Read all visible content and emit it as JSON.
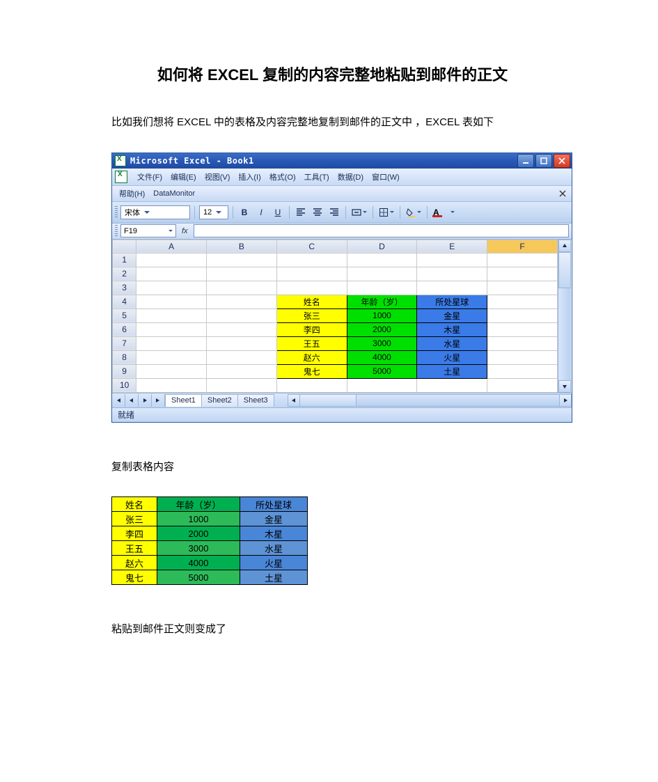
{
  "doc": {
    "title": "如何将 EXCEL  复制的内容完整地粘贴到邮件的正文",
    "para1": "比如我们想将 EXCEL  中的表格及内容完整地复制到邮件的正文中 ，EXCEL  表如下",
    "para2": "复制表格内容",
    "para3": "粘贴到邮件正文则变成了"
  },
  "excel": {
    "title": "Microsoft Excel - Book1",
    "winbtn_min": "minimize-icon",
    "winbtn_max": "maximize-icon",
    "winbtn_close": "close-icon",
    "menu": {
      "file": "文件(F)",
      "edit": "编辑(E)",
      "view": "视图(V)",
      "insert": "插入(I)",
      "format": "格式(O)",
      "tools": "工具(T)",
      "data": "数据(D)",
      "window": "窗口(W)"
    },
    "menu2": {
      "help": "帮助(H)",
      "datamonitor": "DataMonitor"
    },
    "toolbar": {
      "font": "宋体",
      "size": "12",
      "bold": "B",
      "italic": "I",
      "underline": "U"
    },
    "formula": {
      "namebox": "F19",
      "fx": "fx"
    },
    "columns": [
      "A",
      "B",
      "C",
      "D",
      "E",
      "F"
    ],
    "active_col": "F",
    "rows": [
      1,
      2,
      3,
      4,
      5,
      6,
      7,
      8,
      9,
      10
    ],
    "table": {
      "header": {
        "name": "姓名",
        "age": "年龄（岁）",
        "planet": "所处星球"
      },
      "data": [
        {
          "name": "张三",
          "age": "1000",
          "planet": "金星"
        },
        {
          "name": "李四",
          "age": "2000",
          "planet": "木星"
        },
        {
          "name": "王五",
          "age": "3000",
          "planet": "水星"
        },
        {
          "name": "赵六",
          "age": "4000",
          "planet": "火星"
        },
        {
          "name": "鬼七",
          "age": "5000",
          "planet": "土星"
        }
      ]
    },
    "sheets": [
      "Sheet1",
      "Sheet2",
      "Sheet3"
    ],
    "status": "就绪"
  },
  "copied_table": {
    "header": {
      "name": "姓名",
      "age": "年龄（岁）",
      "planet": "所处星球"
    },
    "data": [
      {
        "name": "张三",
        "age": "1000",
        "planet": "金星"
      },
      {
        "name": "李四",
        "age": "2000",
        "planet": "木星"
      },
      {
        "name": "王五",
        "age": "3000",
        "planet": "水星"
      },
      {
        "name": "赵六",
        "age": "4000",
        "planet": "火星"
      },
      {
        "name": "鬼七",
        "age": "5000",
        "planet": "土星"
      }
    ]
  }
}
